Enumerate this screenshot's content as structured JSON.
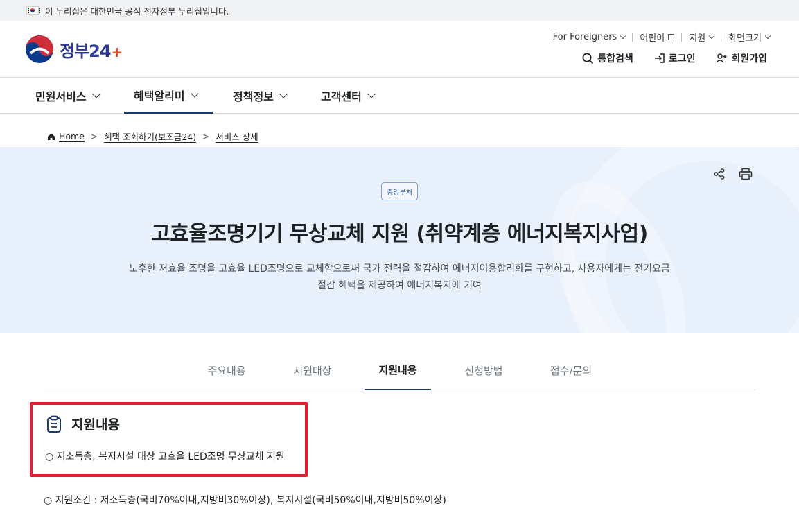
{
  "notice": {
    "text": "이 누리집은 대한민국 공식 전자정부 누리집입니다."
  },
  "logo": {
    "text": "정부24",
    "plus": "+"
  },
  "util_links": [
    {
      "label": "For Foreigners"
    },
    {
      "label": "어린이"
    },
    {
      "label": "지원"
    },
    {
      "label": "화면크기"
    }
  ],
  "actions": {
    "search": "통합검색",
    "login": "로그인",
    "signup": "회원가입"
  },
  "gnb": [
    {
      "label": "민원서비스"
    },
    {
      "label": "혜택알리미"
    },
    {
      "label": "정책정보"
    },
    {
      "label": "고객센터"
    }
  ],
  "breadcrumb": [
    "Home",
    "혜택 조회하기(보조금24)",
    "서비스 상세"
  ],
  "hero": {
    "badge": "중앙부처",
    "title": "고효율조명기기 무상교체 지원 (취약계층 에너지복지사업)",
    "desc_line1": "노후한 저효율 조명을 고효율 LED조명으로 교체함으로써 국가 전력을 절감하여 에너지이용합리화를 구현하고, 사용자에게는 전기요금",
    "desc_line2": "절감 혜택을 제공하여 에너지복지에 기여"
  },
  "tabs": [
    {
      "label": "주요내용"
    },
    {
      "label": "지원대상"
    },
    {
      "label": "지원내용"
    },
    {
      "label": "신청방법"
    },
    {
      "label": "접수/문의"
    }
  ],
  "section": {
    "title": "지원내용",
    "line1": "○ 저소득층, 복지시설 대상 고효율 LED조명 무상교체 지원",
    "line2": "○ 지원조건 : 저소득층(국비70%이내,지방비30%이상), 복지시설(국비50%이내,지방비50%이상)"
  },
  "colors": {
    "accent": "#1b3a6b",
    "hero_bg": "#e8f0fc",
    "highlight_border": "#e0202e",
    "logo_text": "#2b3990",
    "logo_plus": "#e8471b"
  }
}
